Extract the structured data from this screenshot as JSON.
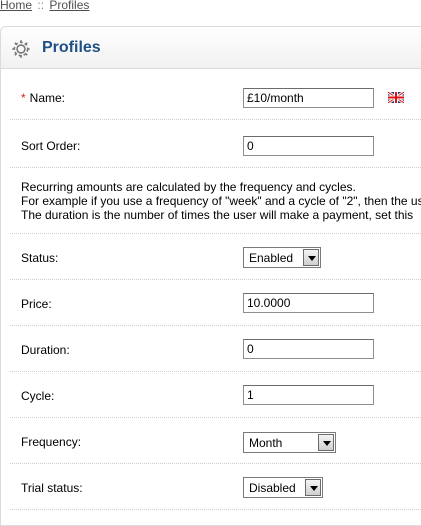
{
  "breadcrumb": {
    "home": "Home",
    "separator": "::",
    "current": "Profiles"
  },
  "panel": {
    "title": "Profiles",
    "icon": "gear-icon"
  },
  "form": {
    "name": {
      "required_marker": "*",
      "label": "Name:",
      "value": "£10/month",
      "language_flag": "uk-flag-icon"
    },
    "sort_order": {
      "label": "Sort Order:",
      "value": "0"
    },
    "info": {
      "line1": "Recurring amounts are calculated by the frequency and cycles.",
      "line2": "For example if you use a frequency of \"week\" and a cycle of \"2\", then the us",
      "line3": "The duration is the number of times the user will make a payment, set this"
    },
    "status": {
      "label": "Status:",
      "value": "Enabled"
    },
    "price": {
      "label": "Price:",
      "value": "10.0000"
    },
    "duration": {
      "label": "Duration:",
      "value": "0"
    },
    "cycle": {
      "label": "Cycle:",
      "value": "1"
    },
    "frequency": {
      "label": "Frequency:",
      "value": "Month"
    },
    "trial_status": {
      "label": "Trial status:",
      "value": "Disabled"
    }
  },
  "colors": {
    "title": "#1f4f86",
    "required": "#e31b1b",
    "breadcrumb": "#4f4f4f"
  }
}
